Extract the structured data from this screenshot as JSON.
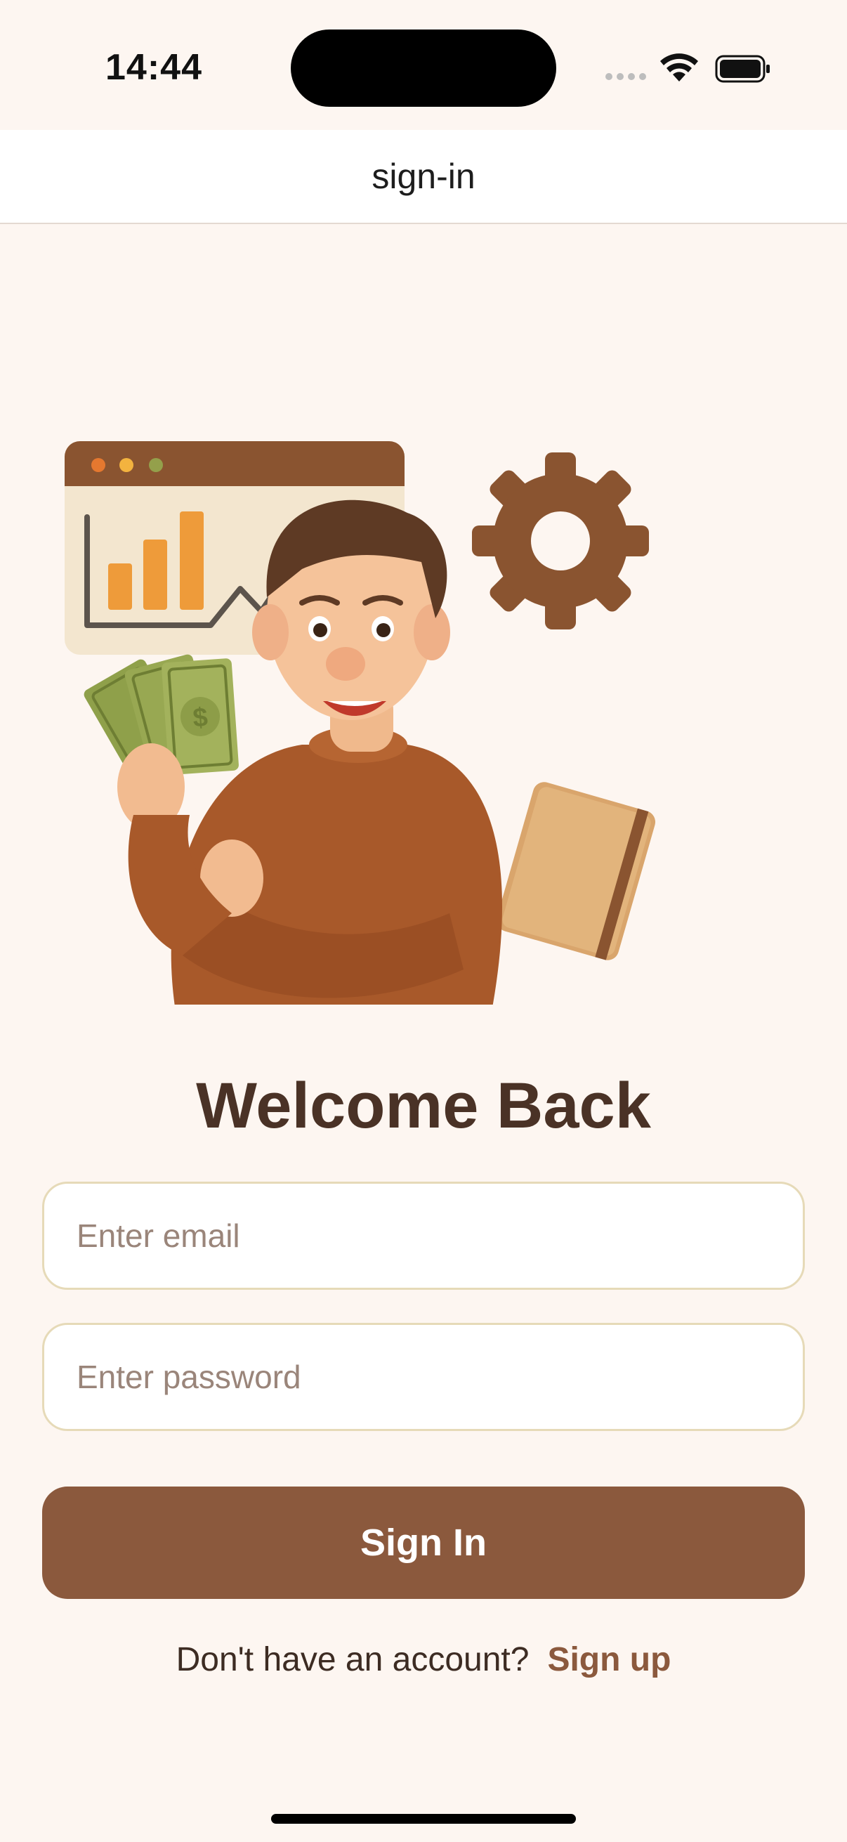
{
  "status_bar": {
    "time": "14:44"
  },
  "nav": {
    "title": "sign-in"
  },
  "hero": {
    "illustration": "illustration of man holding cash with chart, gear and notebook"
  },
  "welcome": {
    "title": "Welcome Back"
  },
  "form": {
    "email_placeholder": "Enter email",
    "email_value": "",
    "password_placeholder": "Enter password",
    "password_value": "",
    "submit_label": "Sign In"
  },
  "signup": {
    "prompt": "Don't have an account?",
    "link_label": "Sign up"
  },
  "colors": {
    "background": "#FDF6F1",
    "accent": "#8B593D",
    "title_text": "#4A3226",
    "input_border": "#E6DAB8"
  }
}
